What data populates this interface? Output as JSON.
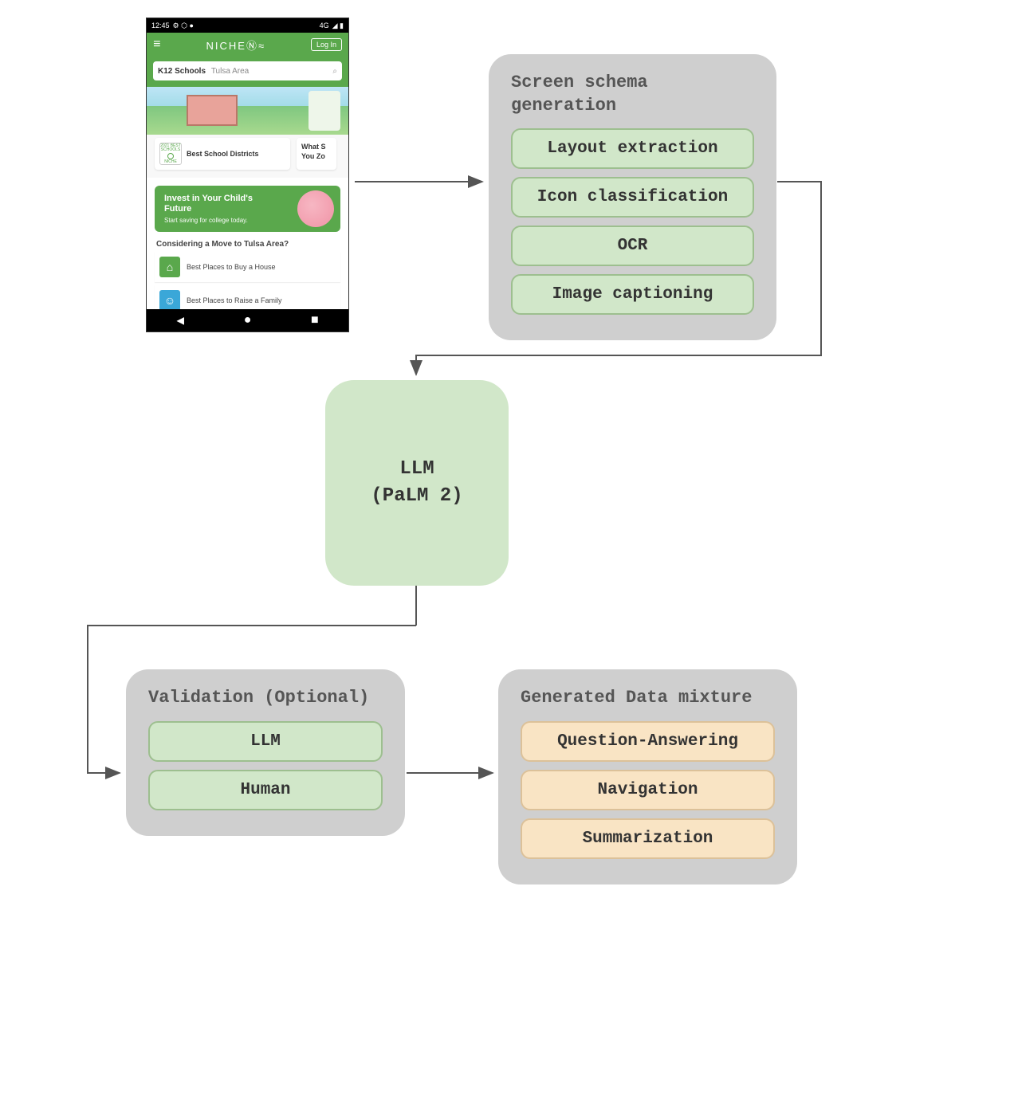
{
  "phone": {
    "status": {
      "time": "12:45",
      "icons_left": "⚙ ⬡ ●",
      "network": "4G",
      "icons_right": "◢ ▮"
    },
    "header": {
      "brand": "NICHE",
      "login": "Log In"
    },
    "search": {
      "category": "K12 Schools",
      "location": "Tulsa Area"
    },
    "badge_lines": {
      "l1": "2021 BEST",
      "l2": "SCHOOLS",
      "l3": "NICHE"
    },
    "card1": "Best School Districts",
    "card2_l1": "What S",
    "card2_l2": "You Zo",
    "promo": {
      "title_l1": "Invest in Your Child's",
      "title_l2": "Future",
      "subtitle": "Start saving for college today."
    },
    "subheading": "Considering a Move to Tulsa Area?",
    "list": [
      {
        "label": "Best Places to Buy a House",
        "color": "#5aa84c",
        "icon": "⌂"
      },
      {
        "label": "Best Places to Raise a Family",
        "color": "#3aa7d8",
        "icon": "☺"
      }
    ]
  },
  "schema_box": {
    "title": "Screen schema generation",
    "items": [
      "Layout extraction",
      "Icon classification",
      "OCR",
      "Image captioning"
    ]
  },
  "llm": {
    "line1": "LLM",
    "line2": "(PaLM 2)"
  },
  "validation_box": {
    "title": "Validation (Optional)",
    "items": [
      "LLM",
      "Human"
    ]
  },
  "data_box": {
    "title": "Generated Data mixture",
    "items": [
      "Question-Answering",
      "Navigation",
      "Summarization"
    ]
  }
}
